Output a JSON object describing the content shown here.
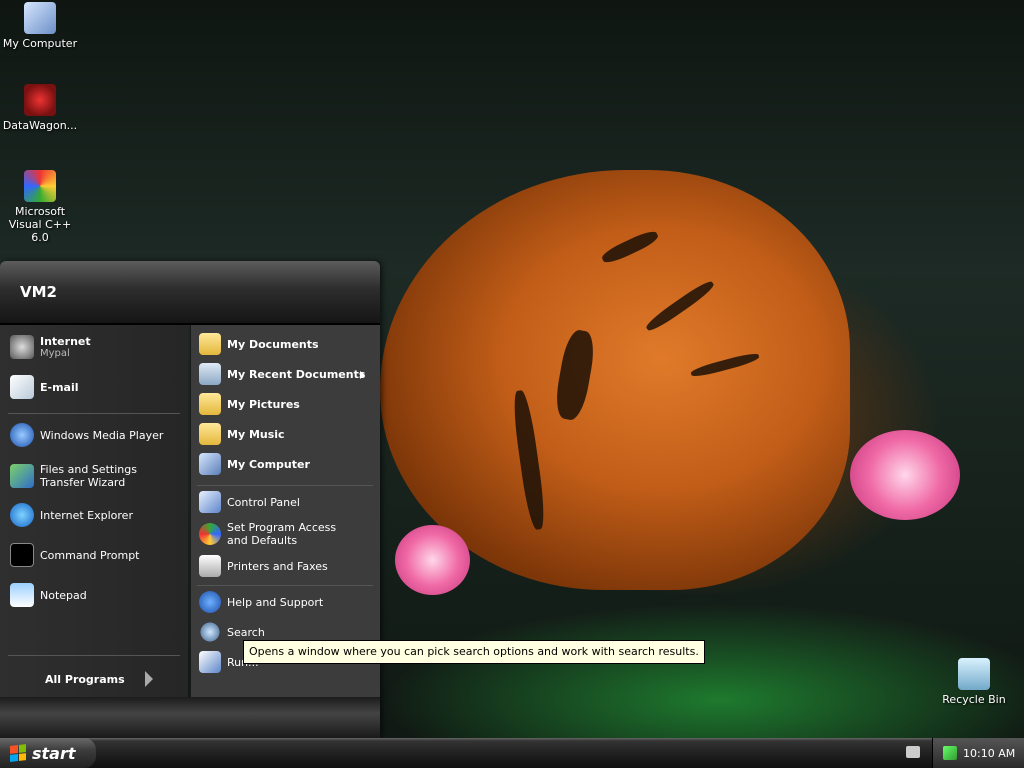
{
  "desktop": {
    "icons": [
      {
        "label": "My Computer",
        "icon": "computer-icon"
      },
      {
        "label": "DataWagon...",
        "icon": "datawagon-icon"
      },
      {
        "label": "Microsoft Visual C++ 6.0",
        "icon": "visual-cpp-icon"
      },
      {
        "label": "Recycle Bin",
        "icon": "recycle-bin-icon"
      }
    ]
  },
  "start_menu": {
    "user": "VM2",
    "pinned": [
      {
        "label": "Internet",
        "sub": "Mypal",
        "icon": "mypal-icon"
      },
      {
        "label": "E-mail",
        "icon": "email-icon"
      }
    ],
    "recent": [
      {
        "label": "Windows Media Player",
        "icon": "media-player-icon"
      },
      {
        "label": "Files and Settings Transfer Wizard",
        "icon": "transfer-wizard-icon"
      },
      {
        "label": "Internet Explorer",
        "icon": "ie-icon"
      },
      {
        "label": "Command Prompt",
        "icon": "cmd-icon"
      },
      {
        "label": "Notepad",
        "icon": "notepad-icon"
      }
    ],
    "all_programs": "All Programs",
    "places": [
      {
        "label": "My Documents",
        "icon": "documents-folder-icon"
      },
      {
        "label": "My Recent Documents",
        "icon": "recent-documents-icon"
      },
      {
        "label": "My Pictures",
        "icon": "pictures-folder-icon"
      },
      {
        "label": "My Music",
        "icon": "music-folder-icon"
      },
      {
        "label": "My Computer",
        "icon": "computer-icon"
      }
    ],
    "settings": [
      {
        "label": "Control Panel",
        "icon": "control-panel-icon"
      },
      {
        "label": "Set Program Access and Defaults",
        "icon": "program-access-icon"
      },
      {
        "label": "Printers and Faxes",
        "icon": "printer-icon"
      }
    ],
    "help": [
      {
        "label": "Help and Support",
        "icon": "help-icon"
      },
      {
        "label": "Search",
        "icon": "search-icon"
      },
      {
        "label": "Run...",
        "icon": "run-icon"
      }
    ]
  },
  "tooltip": "Opens a window where you can pick search options and work with search results.",
  "taskbar": {
    "start_label": "start",
    "clock": "10:10 AM"
  }
}
